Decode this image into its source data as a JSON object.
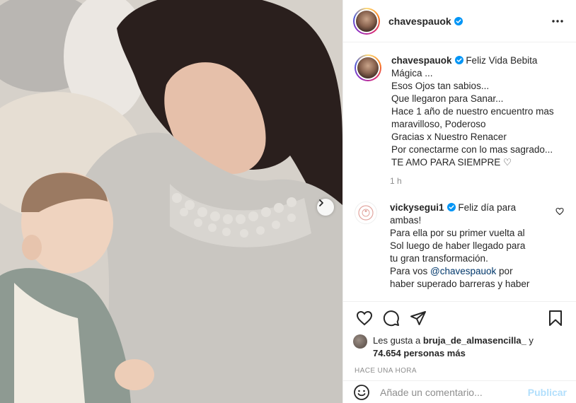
{
  "post": {
    "username": "chavespauok",
    "verified": true
  },
  "caption": {
    "username": "chavespauok",
    "lines": [
      "Feliz Vida Bebita",
      "Mágica ...",
      "Esos Ojos tan sabios...",
      "Que llegaron para Sanar...",
      "Hace 1 año de nuestro encuentro mas",
      "maravilloso, Poderoso",
      "Gracias x Nuestro Renacer",
      "Por conectarme con lo mas sagrado...",
      "TE AMO PARA SIEMPRE ♡"
    ],
    "time": "1 h"
  },
  "comment": {
    "username": "vickysegui1",
    "first": "Feliz día para",
    "lines": [
      "ambas!",
      "Para ella por su primer vuelta al",
      "Sol luego de haber llegado para",
      "tu gran transformación."
    ],
    "mention_prefix": "Para vos ",
    "mention": "@chavespauok",
    "mention_suffix": " por",
    "last": "haber superado barreras y haber"
  },
  "likes": {
    "prefix": "Les gusta a ",
    "user": "bruja_de_almasencilla_",
    "joiner": " y",
    "count": "74.654 personas más"
  },
  "posted": "HACE UNA HORA",
  "add_comment": {
    "placeholder": "Añade un comentario...",
    "publish": "Publicar"
  },
  "colors": {
    "verified": "#0095f6",
    "link": "#00376b",
    "publish": "#b2dffc",
    "muted": "#8e8e8e"
  },
  "icons": [
    "more-icon",
    "heart-icon",
    "comment-icon",
    "share-icon",
    "bookmark-icon",
    "chevron-right-icon",
    "emoji-icon"
  ]
}
